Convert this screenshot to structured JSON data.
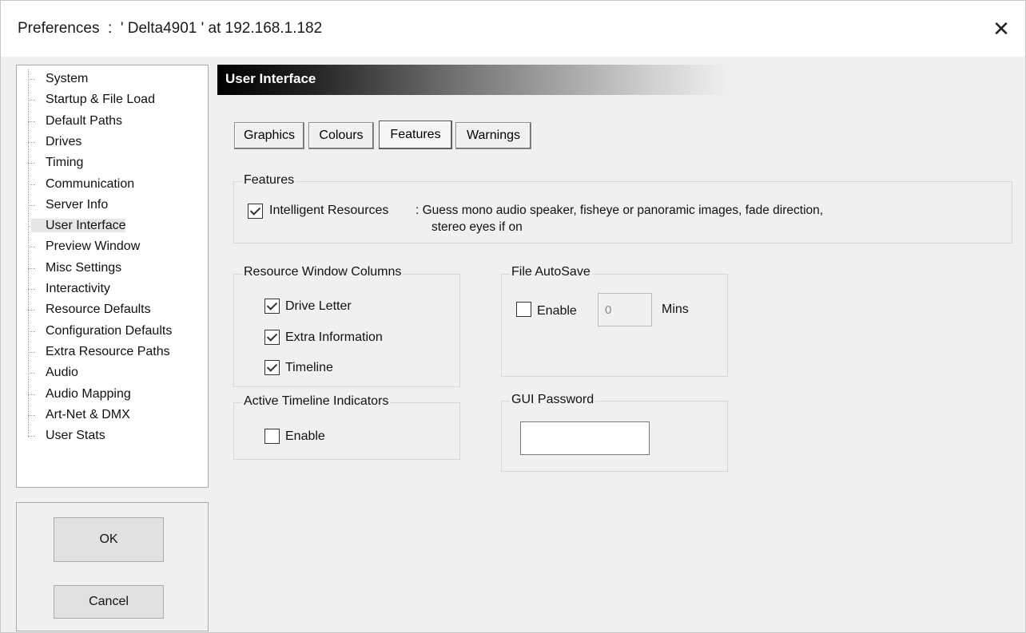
{
  "window": {
    "title": "Preferences  :  ' Delta4901 ' at 192.168.1.182",
    "close_glyph": "✕"
  },
  "sidebar": {
    "items": [
      {
        "label": "System"
      },
      {
        "label": "Startup & File Load"
      },
      {
        "label": "Default Paths"
      },
      {
        "label": "Drives"
      },
      {
        "label": "Timing"
      },
      {
        "label": "Communication"
      },
      {
        "label": "Server Info"
      },
      {
        "label": "User Interface",
        "selected": true
      },
      {
        "label": "Preview Window"
      },
      {
        "label": "Misc Settings"
      },
      {
        "label": "Interactivity"
      },
      {
        "label": "Resource Defaults"
      },
      {
        "label": "Configuration Defaults"
      },
      {
        "label": "Extra Resource Paths"
      },
      {
        "label": "Audio"
      },
      {
        "label": "Audio Mapping"
      },
      {
        "label": "Art-Net & DMX"
      },
      {
        "label": "User Stats"
      }
    ]
  },
  "buttons": {
    "ok_label": "OK",
    "cancel_label": "Cancel"
  },
  "panel": {
    "header": "User Interface",
    "tabs": [
      {
        "label": "Graphics"
      },
      {
        "label": "Colours"
      },
      {
        "label": "Features",
        "active": true
      },
      {
        "label": "Warnings"
      }
    ]
  },
  "features": {
    "group_title": "Features",
    "intelligent_resources": {
      "label": "Intelligent Resources",
      "checked": true,
      "description_line1": ": Guess mono audio speaker, fisheye or panoramic images, fade direction,",
      "description_line2": "stereo eyes if on"
    }
  },
  "resource_columns": {
    "group_title": "Resource Window Columns",
    "options": [
      {
        "label": "Drive Letter",
        "checked": true
      },
      {
        "label": "Extra Information",
        "checked": true
      },
      {
        "label": "Timeline",
        "checked": true
      }
    ]
  },
  "active_timeline": {
    "group_title": "Active Timeline Indicators",
    "enable_label": "Enable",
    "checked": false
  },
  "autosave": {
    "group_title": "File AutoSave",
    "enable_label": "Enable",
    "checked": false,
    "minutes_value": "0",
    "unit_label": "Mins"
  },
  "gui_password": {
    "group_title": "GUI Password",
    "value": ""
  }
}
